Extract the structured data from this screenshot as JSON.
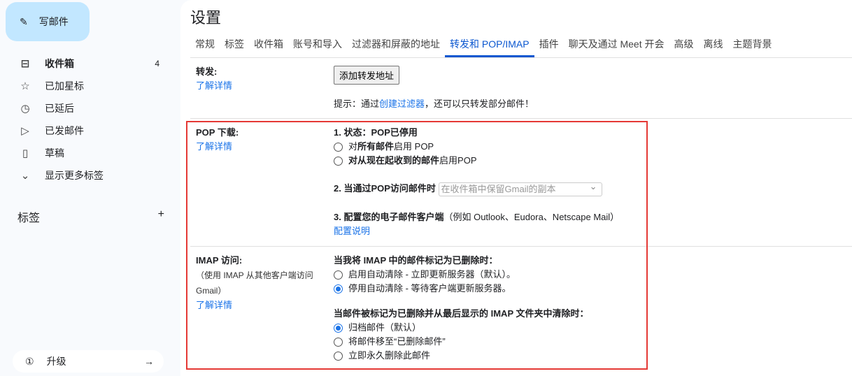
{
  "sidebar": {
    "compose": "写邮件",
    "items": [
      {
        "label": "收件箱",
        "count": "4",
        "icon": "inbox-icon"
      },
      {
        "label": "已加星标",
        "icon": "star-icon"
      },
      {
        "label": "已延后",
        "icon": "clock-icon"
      },
      {
        "label": "已发邮件",
        "icon": "send-icon"
      },
      {
        "label": "草稿",
        "icon": "draft-icon"
      },
      {
        "label": "显示更多标签",
        "icon": "chevron-down-icon"
      }
    ],
    "labels_heading": "标签",
    "upgrade": "升级"
  },
  "title": "设置",
  "tabs": [
    "常规",
    "标签",
    "收件箱",
    "账号和导入",
    "过滤器和屏蔽的地址",
    "转发和 POP/IMAP",
    "插件",
    "聊天及通过 Meet 开会",
    "高级",
    "离线",
    "主题背景"
  ],
  "forwarding": {
    "label": "转发:",
    "learn_more": "了解详情",
    "add_button": "添加转发地址",
    "tip_prefix": "提示：通过",
    "tip_link": "创建过滤器",
    "tip_suffix": "，还可以只转发部分邮件！"
  },
  "pop": {
    "label": "POP 下载:",
    "learn_more": "了解详情",
    "status_label": "1. 状态：",
    "status_value": "POP已停用",
    "opt1_a": "对",
    "opt1_b": "所有邮件",
    "opt1_c": "启用 POP",
    "opt2_a": "对",
    "opt2_b": "从现在起收到的邮件",
    "opt2_c": "启用POP",
    "when_label": "2. 当通过POP访问邮件时",
    "when_select": "在收件箱中保留Gmail的副本",
    "config_label": "3. 配置您的电子邮件客户端",
    "config_hint": "（例如 Outlook、Eudora、Netscape Mail）",
    "config_link": "配置说明"
  },
  "imap": {
    "label": "IMAP 访问:",
    "sub": "（使用 IMAP 从其他客户端访问 Gmail）",
    "learn_more": "了解详情",
    "q1": "当我将 IMAP 中的邮件标记为已删除时：",
    "q1_opts": [
      "启用自动清除 - 立即更新服务器（默认）。",
      "停用自动清除 - 等待客户端更新服务器。"
    ],
    "q1_selected": 1,
    "q2": "当邮件被标记为已删除并从最后显示的 IMAP 文件夹中清除时：",
    "q2_opts": [
      "归档邮件（默认）",
      "将邮件移至“已删除邮件”",
      "立即永久删除此邮件"
    ],
    "q2_selected": 0
  },
  "colors": {
    "accent": "#0b57d0",
    "highlight": "#e53935"
  }
}
